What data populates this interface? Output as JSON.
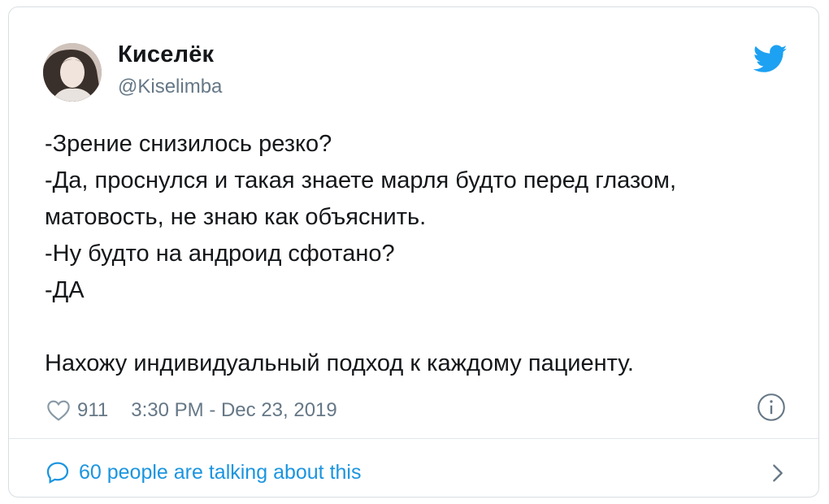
{
  "tweet": {
    "author": {
      "display_name": "Киселёк",
      "handle": "@Kiselimba",
      "avatar_icon": "user-avatar"
    },
    "brand_icon": "twitter-bird-icon",
    "brand_color": "#1da1f2",
    "lines": [
      "-Зрение снизилось резко?",
      "-Да, проснулся и такая знаете марля будто перед глазом,",
      "матовость, не знаю как объяснить.",
      "-Ну будто на андроид сфотано?",
      "-ДА",
      "",
      "Нахожу индивидуальный подход к каждому пациенту."
    ],
    "likes": "911",
    "timestamp": "3:30 PM - Dec 23, 2019",
    "info_icon": "info-icon",
    "talking": "60 people are talking about this",
    "link_color": "#1b95e0"
  }
}
